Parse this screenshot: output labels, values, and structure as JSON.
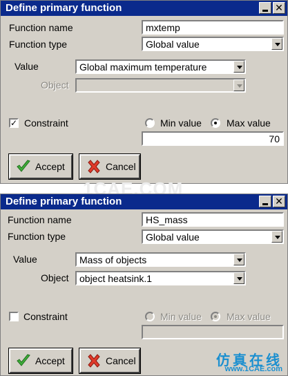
{
  "watermark": "1CAE.COM",
  "watermark2": {
    "line1": "仿真在线",
    "line2": "www.1CAE.com"
  },
  "dialog1": {
    "title": "Define primary function",
    "function_name_label": "Function name",
    "function_name_value": "mxtemp",
    "function_type_label": "Function type",
    "function_type_value": "Global value",
    "value_label": "Value",
    "value_value": "Global maximum temperature",
    "object_label": "Object",
    "object_value": "",
    "constraint_label": "Constraint",
    "constraint_checked": true,
    "min_label": "Min value",
    "max_label": "Max value",
    "selected_radio": "max",
    "limit_value": "70",
    "accept_label": "Accept",
    "cancel_label": "Cancel"
  },
  "dialog2": {
    "title": "Define primary function",
    "function_name_label": "Function name",
    "function_name_value": "HS_mass",
    "function_type_label": "Function type",
    "function_type_value": "Global value",
    "value_label": "Value",
    "value_value": "Mass of objects",
    "object_label": "Object",
    "object_value": "object heatsink.1",
    "constraint_label": "Constraint",
    "constraint_checked": false,
    "min_label": "Min value",
    "max_label": "Max value",
    "selected_radio": "max",
    "limit_value": "",
    "accept_label": "Accept",
    "cancel_label": "Cancel"
  }
}
